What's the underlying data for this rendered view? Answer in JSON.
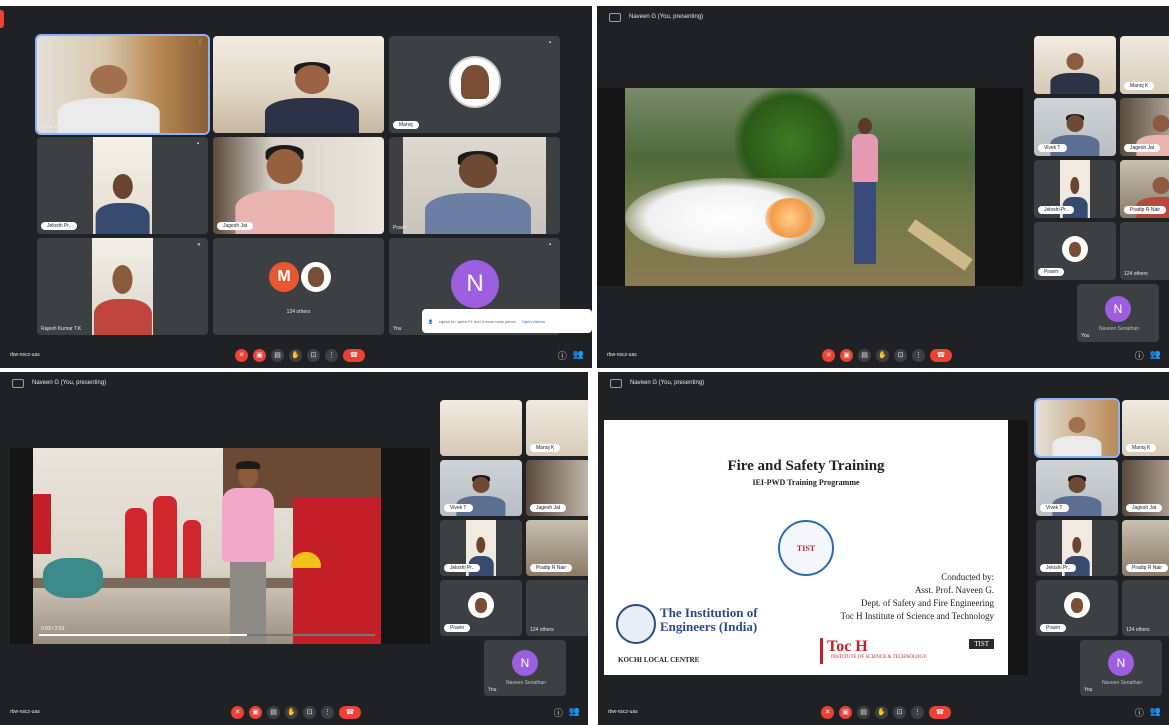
{
  "panels": [
    {
      "id": "grid",
      "meeting_code": "rbw-nscz-uas",
      "tiles": [
        {
          "name": "Hrisk Jacob",
          "kind": "camera",
          "active": true
        },
        {
          "name": "",
          "kind": "camera",
          "active": false
        },
        {
          "name": "Manoj",
          "kind": "camera",
          "active": false
        },
        {
          "name": "Jeloshi Pr..",
          "kind": "camera",
          "active": false
        },
        {
          "name": "Jagesh Jat",
          "kind": "camera",
          "active": false
        },
        {
          "name": "Pravin",
          "kind": "camera",
          "active": false
        },
        {
          "name": "Rajesh Kumar T.K",
          "kind": "camera",
          "active": false
        },
        {
          "name": "124 others",
          "kind": "others",
          "avatar_letter": "M",
          "avatar_color": "#e8572f"
        },
        {
          "name": "You",
          "kind": "avatar",
          "avatar_letter": "N",
          "avatar_color": "#9c5fe0"
        }
      ],
      "popup": {
        "text": "rajesh kt / ajesh PL and 3 more have joined",
        "action": "Open visitors"
      }
    },
    {
      "id": "video-demo",
      "header": "Naveen G (You, presenting)",
      "meeting_code": "rbw-nscz-uas",
      "side_tiles": [
        {
          "name": ""
        },
        {
          "name": "Manoj K"
        },
        {
          "name": "Vivek T"
        },
        {
          "name": "Jagesh Jat"
        },
        {
          "name": "Jeloshi Pr.."
        },
        {
          "name": "Pradip R Nair"
        },
        {
          "name": "Pravin"
        },
        {
          "name": "124 others"
        },
        {
          "name": "You",
          "avatar_letter": "N",
          "avatar_color": "#9c5fe0"
        }
      ],
      "presenting_label": "Naveen Senathan"
    },
    {
      "id": "video-talk",
      "header": "Naveen G (You, presenting)",
      "meeting_code": "rbw-nscz-uas",
      "side_tiles": [
        {
          "name": ""
        },
        {
          "name": "Manoj K"
        },
        {
          "name": "Vivek T"
        },
        {
          "name": "Jagesh Jat"
        },
        {
          "name": "Jeloshi Pr.."
        },
        {
          "name": "Pradip R Nair"
        },
        {
          "name": "Pravin"
        },
        {
          "name": "124 others"
        },
        {
          "name": "You",
          "avatar_letter": "N",
          "avatar_color": "#9c5fe0"
        }
      ],
      "video_time": "0:03 / 2:51",
      "presenting_label": "Naveen Senathan"
    },
    {
      "id": "slide",
      "header": "Naveen G (You, presenting)",
      "meeting_code": "rbw-nscz-uas",
      "side_tiles": [
        {
          "name": ""
        },
        {
          "name": "Manoj K"
        },
        {
          "name": "Vivek T"
        },
        {
          "name": "Jagesh Jat"
        },
        {
          "name": "Jeloshi Pr.."
        },
        {
          "name": "Pradip R Nair"
        },
        {
          "name": "Pravin"
        },
        {
          "name": "124 others"
        },
        {
          "name": "You",
          "avatar_letter": "N",
          "avatar_color": "#9c5fe0"
        }
      ],
      "presenting_label": "Naveen Senathan",
      "slide": {
        "title": "Fire and Safety Training",
        "subtitle": "IEI-PWD Training Programme",
        "seal_text": "TIST",
        "conducted_by": "Conducted by:",
        "presenter": "Asst. Prof. Naveen G.",
        "dept": "Dept. of Safety and Fire Engineering",
        "institute": "Toc H Institute of Science and Technology",
        "iei_name_1": "The Institution of",
        "iei_name_2": "Engineers (India)",
        "iei_centre": "KOCHI LOCAL CENTRE",
        "toch_logo": "Toc H",
        "toch_sub": "INSTITUTE OF SCIENCE & TECHNOLOGY",
        "tist_logo": "TIST"
      }
    }
  ],
  "controls": {
    "icons": [
      "mic-off-icon",
      "camera-off-icon",
      "captions-icon",
      "hand-icon",
      "present-icon",
      "more-icon",
      "end-call-icon"
    ],
    "right_icons": [
      "info-icon",
      "people-icon"
    ]
  }
}
